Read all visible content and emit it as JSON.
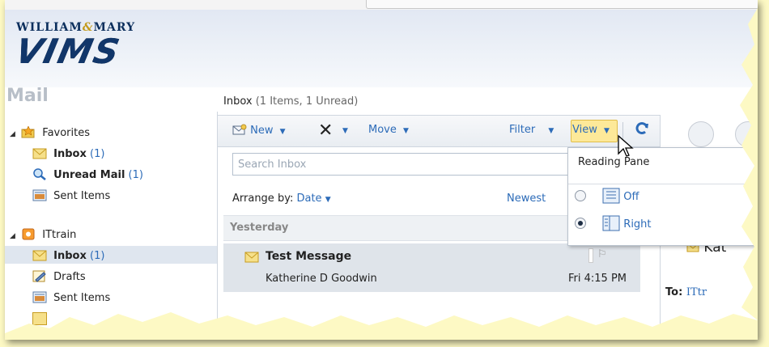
{
  "header": {
    "logo_line1": "WILLIAM",
    "logo_amp": "&",
    "logo_line2": "MARY",
    "logo_main": "VIMS"
  },
  "left_pane": {
    "title": "Mail",
    "favorites": {
      "label": "Favorites",
      "items": [
        {
          "label": "Inbox",
          "count": "(1)",
          "bold": true
        },
        {
          "label": "Unread Mail",
          "count": "(1)",
          "bold": true
        },
        {
          "label": "Sent Items",
          "count": "",
          "bold": false
        }
      ]
    },
    "account": {
      "label": "ITtrain",
      "items": [
        {
          "label": "Inbox",
          "count": "(1)",
          "bold": true
        },
        {
          "label": "Drafts",
          "count": "",
          "bold": false
        },
        {
          "label": "Sent Items",
          "count": "",
          "bold": false
        }
      ]
    }
  },
  "list": {
    "header_title": "Inbox",
    "header_counts": "(1 Items, 1 Unread)",
    "toolbar": {
      "new": "New",
      "move": "Move",
      "filter": "Filter",
      "view": "View"
    },
    "search_placeholder": "Search Inbox",
    "arrange_label": "Arrange by:",
    "arrange_value": "Date",
    "sort_label": "Newest",
    "group_label": "Yesterday",
    "messages": [
      {
        "subject": "Test Message",
        "from": "Katherine D Goodwin",
        "date": "Fri 4:15 PM"
      }
    ]
  },
  "view_menu": {
    "header": "Reading Pane",
    "options": [
      {
        "label": "Off",
        "selected": false
      },
      {
        "label": "Right",
        "selected": true
      }
    ]
  },
  "reading_pane": {
    "sender_partial": "Kat",
    "to_label": "To:",
    "to_value": "ITtr"
  },
  "colors": {
    "link": "#2c6bb8",
    "view_highlight": "#fde999",
    "selection": "#dfe4ea",
    "border": "#fdf9c4"
  }
}
